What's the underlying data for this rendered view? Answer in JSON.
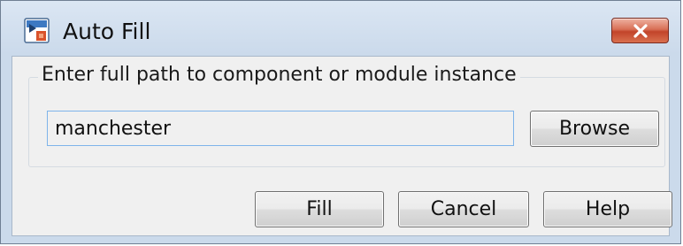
{
  "window": {
    "title": "Auto Fill",
    "icon": "simulink-block-icon",
    "close_icon": "close-x-icon"
  },
  "group": {
    "label": "Enter full path to component or module instance"
  },
  "path_field": {
    "value": "manchester"
  },
  "buttons": {
    "browse": "Browse",
    "fill": "Fill",
    "cancel": "Cancel",
    "help": "Help"
  },
  "colors": {
    "frame": "#cbdaeb",
    "client": "#f0f0f0",
    "close_button": "#c2442a",
    "input_border": "#7eb4ea"
  }
}
